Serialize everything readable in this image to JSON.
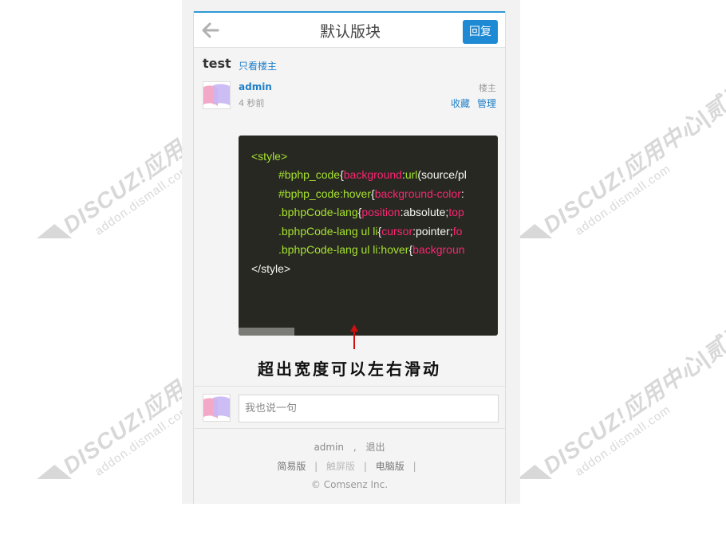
{
  "header": {
    "title": "默认版块",
    "reply_label": "回复",
    "back_icon": "arrow-left-icon"
  },
  "thread": {
    "title": "test",
    "only_op_label": "只看楼主"
  },
  "post": {
    "author": "admin",
    "time": "4 秒前",
    "floor": "楼主",
    "favorite_label": "收藏",
    "manage_label": "管理",
    "code_lines": [
      "<style>",
      "#bphp_code{background:url(source/pl",
      "#bphp_code:hover{background-color:",
      ".bphpCode-lang{position:absolute;top",
      ".bphpCode-lang ul li{cursor:pointer;fo",
      ".bphpCode-lang ul li:hover{backgroun",
      "</style>"
    ],
    "caption": "超出宽度可以左右滑动"
  },
  "reply_box": {
    "placeholder": "我也说一句"
  },
  "footer": {
    "user": "admin",
    "logout": "退出",
    "links": [
      "简易版",
      "触屏版",
      "电脑版"
    ],
    "copyright": "© Comsenz Inc."
  },
  "watermark": {
    "brand": "DISCUZ!应用中心|贰道",
    "domain": "addon.dismall.com"
  },
  "colors": {
    "accent": "#1e8ad4",
    "code_bg": "#272822",
    "code_tag": "#a6e22e",
    "code_prop": "#f92672",
    "arrow": "#d01010"
  }
}
